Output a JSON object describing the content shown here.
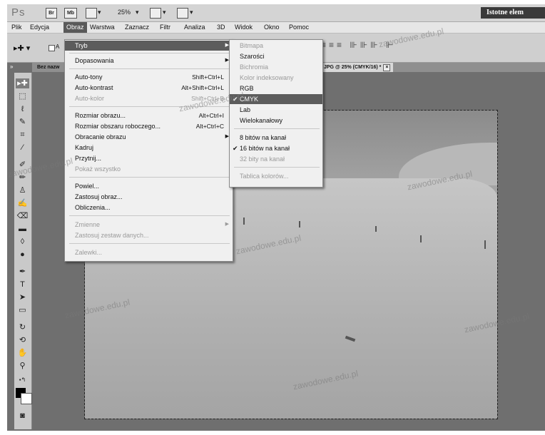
{
  "appbar": {
    "logo": "Ps",
    "btn_br": "Br",
    "btn_mb": "Mb",
    "zoom": "25%",
    "workspace": "Istotne elem"
  },
  "menubar": [
    "Plik",
    "Edycja",
    "Obraz",
    "Warstwa",
    "Zaznacz",
    "Filtr",
    "Analiza",
    "3D",
    "Widok",
    "Okno",
    "Pomoc"
  ],
  "options": {
    "auto_label": "A"
  },
  "tabs": {
    "left": "Bez nazw",
    "doc": "JPG @ 25% (CMYK/16) *",
    "close": "×"
  },
  "obraz_menu": [
    {
      "label": "Tryb",
      "shortcut": "",
      "submenu": true,
      "highlighted": true,
      "disabled": false
    },
    {
      "label": "Dopasowania",
      "shortcut": "",
      "submenu": true,
      "highlighted": false,
      "disabled": false
    },
    {
      "label": "Auto-tony",
      "shortcut": "Shift+Ctrl+L",
      "submenu": false,
      "highlighted": false,
      "disabled": false
    },
    {
      "label": "Auto-kontrast",
      "shortcut": "Alt+Shift+Ctrl+L",
      "submenu": false,
      "highlighted": false,
      "disabled": false
    },
    {
      "label": "Auto-kolor",
      "shortcut": "Shift+Ctrl+B",
      "submenu": false,
      "highlighted": false,
      "disabled": true
    },
    {
      "label": "Rozmiar obrazu...",
      "shortcut": "Alt+Ctrl+I",
      "submenu": false,
      "highlighted": false,
      "disabled": false
    },
    {
      "label": "Rozmiar obszaru roboczego...",
      "shortcut": "Alt+Ctrl+C",
      "submenu": false,
      "highlighted": false,
      "disabled": false
    },
    {
      "label": "Obracanie obrazu",
      "shortcut": "",
      "submenu": true,
      "highlighted": false,
      "disabled": false
    },
    {
      "label": "Kadruj",
      "shortcut": "",
      "submenu": false,
      "highlighted": false,
      "disabled": false
    },
    {
      "label": "Przytnij...",
      "shortcut": "",
      "submenu": false,
      "highlighted": false,
      "disabled": false
    },
    {
      "label": "Pokaż wszystko",
      "shortcut": "",
      "submenu": false,
      "highlighted": false,
      "disabled": true
    },
    {
      "label": "Powiel...",
      "shortcut": "",
      "submenu": false,
      "highlighted": false,
      "disabled": false
    },
    {
      "label": "Zastosuj obraz...",
      "shortcut": "",
      "submenu": false,
      "highlighted": false,
      "disabled": false
    },
    {
      "label": "Obliczenia...",
      "shortcut": "",
      "submenu": false,
      "highlighted": false,
      "disabled": false
    },
    {
      "label": "Zmienne",
      "shortcut": "",
      "submenu": true,
      "highlighted": false,
      "disabled": true
    },
    {
      "label": "Zastosuj zestaw danych...",
      "shortcut": "",
      "submenu": false,
      "highlighted": false,
      "disabled": true
    },
    {
      "label": "Zalewki...",
      "shortcut": "",
      "submenu": false,
      "highlighted": false,
      "disabled": true
    }
  ],
  "tryb_menu": [
    {
      "label": "Bitmapa",
      "checked": false,
      "highlighted": false,
      "disabled": true
    },
    {
      "label": "Szarości",
      "checked": false,
      "highlighted": false,
      "disabled": false
    },
    {
      "label": "Bichromia",
      "checked": false,
      "highlighted": false,
      "disabled": true
    },
    {
      "label": "Kolor indeksowany",
      "checked": false,
      "highlighted": false,
      "disabled": true
    },
    {
      "label": "RGB",
      "checked": false,
      "highlighted": false,
      "disabled": false
    },
    {
      "label": "CMYK",
      "checked": true,
      "highlighted": true,
      "disabled": false
    },
    {
      "label": "Lab",
      "checked": false,
      "highlighted": false,
      "disabled": false
    },
    {
      "label": "Wielokanałowy",
      "checked": false,
      "highlighted": false,
      "disabled": false
    },
    {
      "label": "8 bitów na kanał",
      "checked": false,
      "highlighted": false,
      "disabled": false
    },
    {
      "label": "16 bitów na kanał",
      "checked": true,
      "highlighted": false,
      "disabled": false
    },
    {
      "label": "32 bity na kanał",
      "checked": false,
      "highlighted": false,
      "disabled": true
    },
    {
      "label": "Tablica kolorów...",
      "checked": false,
      "highlighted": false,
      "disabled": true
    }
  ],
  "watermark": "zawodowe.edu.pl"
}
